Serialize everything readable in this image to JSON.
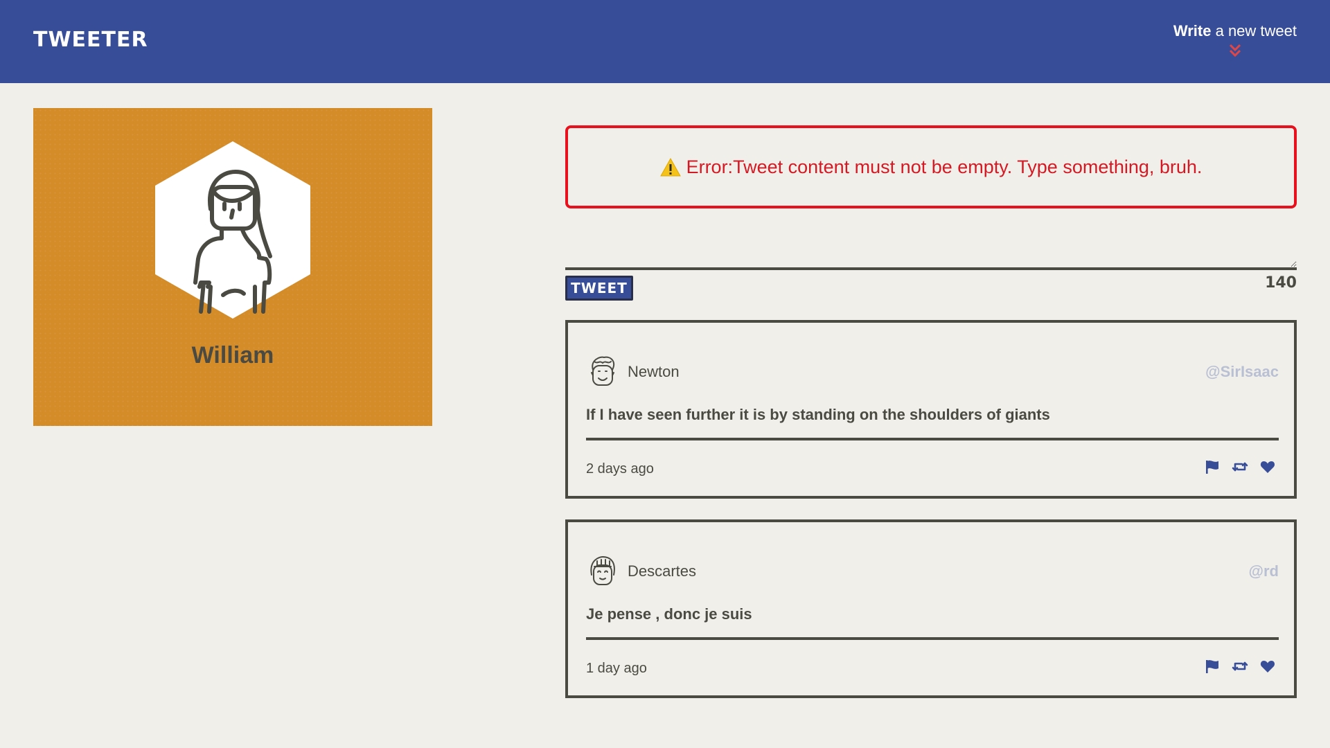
{
  "nav": {
    "brand": "Tweeter",
    "compose_bold": "Write",
    "compose_rest": " a new tweet"
  },
  "profile": {
    "name": "William",
    "background_color": "#d48c29"
  },
  "error": {
    "message": "Error:Tweet content must not be empty. Type something, bruh.",
    "color": "#e8101c"
  },
  "composer": {
    "value": "",
    "button_label": "TWEET",
    "counter": "140"
  },
  "tweets": [
    {
      "author": "Newton",
      "handle": "@SirIsaac",
      "content": "If I have seen further it is by standing on the shoulders of giants",
      "timestamp": "2 days ago"
    },
    {
      "author": "Descartes",
      "handle": "@rd",
      "content": "Je pense , donc je suis",
      "timestamp": "1 day ago"
    }
  ],
  "icons": {
    "flag": "flag-icon",
    "retweet": "retweet-icon",
    "like": "heart-icon",
    "warning": "warning-icon",
    "compose": "chevron-double-down-icon"
  },
  "colors": {
    "nav": "#384d98",
    "accent_red": "#e04646",
    "text": "#4a4a42",
    "handle": "#b9c0d4",
    "background": "#f1efea"
  }
}
